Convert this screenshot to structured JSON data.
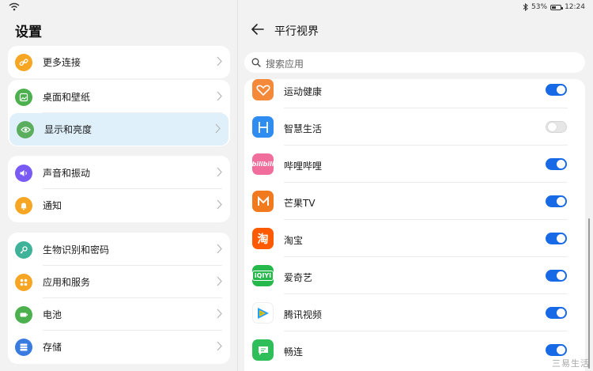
{
  "status": {
    "battery": "53%",
    "time": "12:24",
    "battery_level": 0.53
  },
  "settings": {
    "title": "设置",
    "groups": [
      [
        {
          "label": "更多连接",
          "icon": "link-icon",
          "color": "#f6a623"
        }
      ],
      [
        {
          "label": "桌面和壁纸",
          "icon": "wallpaper-icon",
          "color": "#4cb04f"
        },
        {
          "label": "显示和亮度",
          "icon": "eye-icon",
          "color": "#5cae5f",
          "selected": true
        }
      ],
      [
        {
          "label": "声音和振动",
          "icon": "speaker-icon",
          "color": "#7a5af5"
        },
        {
          "label": "通知",
          "icon": "bell-icon",
          "color": "#f6a623"
        }
      ],
      [
        {
          "label": "生物识别和密码",
          "icon": "key-icon",
          "color": "#3fb39a"
        },
        {
          "label": "应用和服务",
          "icon": "apps-icon",
          "color": "#f6a623"
        },
        {
          "label": "电池",
          "icon": "battery-icon",
          "color": "#4cb04f"
        },
        {
          "label": "存储",
          "icon": "storage-icon",
          "color": "#3a7be0"
        }
      ]
    ]
  },
  "detail": {
    "title": "平行视界",
    "search_placeholder": "搜索应用",
    "apps": [
      {
        "name": "运动健康",
        "icon": "health-app-icon",
        "color": "#f5893a",
        "enabled": true
      },
      {
        "name": "智慧生活",
        "icon": "smart-life-app-icon",
        "color": "#2f8cf0",
        "enabled": false
      },
      {
        "name": "哔哩哔哩",
        "icon": "bilibili-app-icon",
        "color": "#f06d9c",
        "enabled": true
      },
      {
        "name": "芒果TV",
        "icon": "mango-tv-app-icon",
        "color": "#f27a1e",
        "enabled": true
      },
      {
        "name": "淘宝",
        "icon": "taobao-app-icon",
        "color": "#ff5a00",
        "enabled": true
      },
      {
        "name": "爱奇艺",
        "icon": "iqiyi-app-icon",
        "color": "#25b84a",
        "enabled": true
      },
      {
        "name": "腾讯视频",
        "icon": "tencent-video-app-icon",
        "color": "#ffffff",
        "enabled": true
      },
      {
        "name": "畅连",
        "icon": "meetime-app-icon",
        "color": "#2fbf5a",
        "enabled": true
      }
    ]
  },
  "watermark": "三易生活"
}
